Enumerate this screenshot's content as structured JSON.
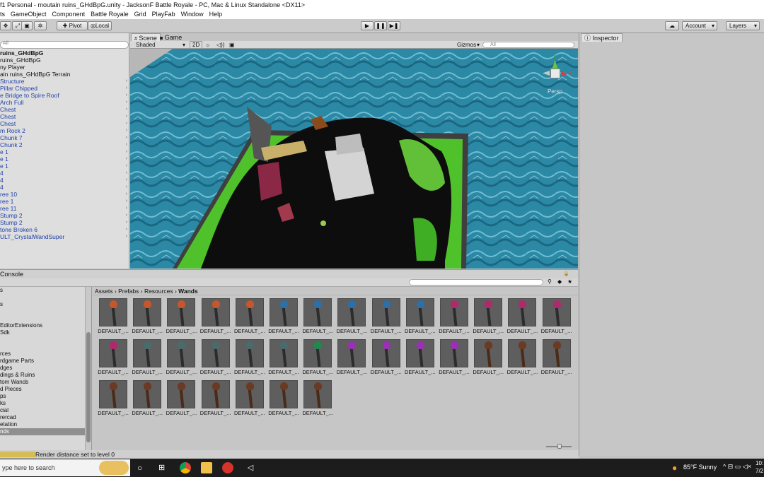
{
  "window": {
    "title": "f1 Personal - moutain ruins_GHdBpG.unity - JacksonF Battle Royale - PC, Mac & Linux Standalone <DX11>"
  },
  "menu": [
    "ts",
    "GameObject",
    "Component",
    "Battle Royale",
    "Grid",
    "PlayFab",
    "Window",
    "Help"
  ],
  "toolbar": {
    "pivot_label": "Pivot",
    "local_label": "Local",
    "account_label": "Account",
    "layers_label": "Layers"
  },
  "hierarchy": {
    "search_placeholder": "All",
    "items": [
      {
        "label": "ruins_GHdBpG",
        "kind": "scene"
      },
      {
        "label": "ruins_GHdBpG",
        "kind": "plain",
        "arrow": false
      },
      {
        "label": "ny Player",
        "kind": "plain",
        "arrow": false
      },
      {
        "label": "ain ruins_GHdBpG Terrain",
        "kind": "plain",
        "arrow": false
      },
      {
        "label": "Structure",
        "kind": "prefab",
        "arrow": true
      },
      {
        "label": "Pillar Chipped",
        "kind": "prefab",
        "arrow": true
      },
      {
        "label": "e Bridge to Spire Roof",
        "kind": "prefab",
        "arrow": true
      },
      {
        "label": "Arch Full",
        "kind": "prefab",
        "arrow": true
      },
      {
        "label": "Chest",
        "kind": "prefab",
        "arrow": true
      },
      {
        "label": "Chest",
        "kind": "prefab",
        "arrow": true
      },
      {
        "label": "Chest",
        "kind": "prefab",
        "arrow": true
      },
      {
        "label": "m Rock 2",
        "kind": "prefab",
        "arrow": true
      },
      {
        "label": "Chunk 7",
        "kind": "prefab",
        "arrow": true
      },
      {
        "label": "Chunk 2",
        "kind": "prefab",
        "arrow": true
      },
      {
        "label": "e 1",
        "kind": "prefab",
        "arrow": true
      },
      {
        "label": "e 1",
        "kind": "prefab",
        "arrow": true
      },
      {
        "label": "e 1",
        "kind": "prefab",
        "arrow": true
      },
      {
        "label": "4",
        "kind": "prefab",
        "arrow": true
      },
      {
        "label": "4",
        "kind": "prefab",
        "arrow": true
      },
      {
        "label": "4",
        "kind": "prefab",
        "arrow": true
      },
      {
        "label": "ree 10",
        "kind": "prefab",
        "arrow": true
      },
      {
        "label": "ree 1",
        "kind": "prefab",
        "arrow": true
      },
      {
        "label": "ree 11",
        "kind": "prefab",
        "arrow": true
      },
      {
        "label": "Stump 2",
        "kind": "prefab",
        "arrow": true
      },
      {
        "label": "Stump 2",
        "kind": "prefab",
        "arrow": true
      },
      {
        "label": "tone Broken 6",
        "kind": "prefab",
        "arrow": true
      },
      {
        "label": "ULT_CrystalWandSuper",
        "kind": "prefab",
        "arrow": true
      }
    ]
  },
  "scene": {
    "tab_scene": "Scene",
    "tab_game": "Game",
    "shading_mode": "Shaded",
    "mode_2d": "2D",
    "gizmos_label": "Gizmos",
    "search_placeholder": "All",
    "persp_label": "Persp",
    "axis_x": "x",
    "axis_y": "y",
    "colors": {
      "water": "#2a8aa8",
      "terrain_dark": "#0d0d0d",
      "terrain_green": "#4fc22b"
    }
  },
  "inspector": {
    "tab_label": "Inspector"
  },
  "bottom": {
    "console_tab": "Console",
    "breadcrumb": [
      "Assets",
      "Prefabs",
      "Resources",
      "Wands"
    ],
    "folders": [
      {
        "label": "s",
        "selected": false
      },
      {
        "label": "",
        "selected": false
      },
      {
        "label": "s",
        "selected": false
      },
      {
        "label": "",
        "selected": false
      },
      {
        "label": "",
        "selected": false
      },
      {
        "label": "EditorExtensions",
        "selected": false
      },
      {
        "label": "Sdk",
        "selected": false
      },
      {
        "label": "",
        "selected": false
      },
      {
        "label": "",
        "selected": false
      },
      {
        "label": "rces",
        "selected": false
      },
      {
        "label": "rdgame Parts",
        "selected": false
      },
      {
        "label": "dges",
        "selected": false
      },
      {
        "label": "dings & Ruins",
        "selected": false
      },
      {
        "label": "tom Wands",
        "selected": false
      },
      {
        "label": "d Pieces",
        "selected": false
      },
      {
        "label": "ps",
        "selected": false
      },
      {
        "label": "ks",
        "selected": false
      },
      {
        "label": "cial",
        "selected": false
      },
      {
        "label": "rercad",
        "selected": false
      },
      {
        "label": "etation",
        "selected": false
      },
      {
        "label": "nds",
        "selected": true
      }
    ],
    "asset_label": "DEFAULT_...",
    "wands": [
      "#c4572b",
      "#c4572b",
      "#c4572b",
      "#c4572b",
      "#c4572b",
      "#2d6fa8",
      "#2d6fa8",
      "#2d6fa8",
      "#2d6fa8",
      "#2d6fa8",
      "#b0296e",
      "#b0296e",
      "#b0296e",
      "#b0296e",
      "#b0296e",
      "#4a6b6b",
      "#4a6b6b",
      "#4a6b6b",
      "#4a6b6b",
      "#4a6b6b",
      "#1f8a4a",
      "#9b2fb5",
      "#9b2fb5",
      "#9b2fb5",
      "#9b2fb5",
      "#6b3a24",
      "#6b3a24",
      "#6b3a24",
      "#6b3a24",
      "#6b3a24",
      "#6b3a24",
      "#6b3a24",
      "#6b3a24",
      "#6b3a24",
      "#6b3a24"
    ]
  },
  "status": {
    "message": "Render distance set to level 0"
  },
  "taskbar": {
    "search_placeholder": "ype here to search",
    "weather": "85°F  Sunny",
    "time": "10:",
    "date": "7/2"
  }
}
